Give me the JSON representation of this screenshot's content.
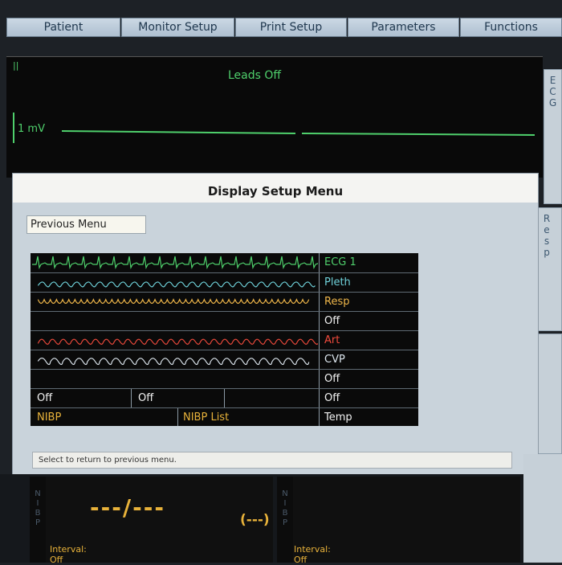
{
  "menu": {
    "tabs": [
      "Patient",
      "Monitor Setup",
      "Print Setup",
      "Parameters",
      "Functions"
    ]
  },
  "ecg_area": {
    "marker": "||",
    "status": "Leads Off",
    "scale": "1 mV",
    "side_label": [
      "E",
      "C",
      "G"
    ]
  },
  "resp_side_label": [
    "R",
    "e",
    "s",
    "p"
  ],
  "dialog": {
    "title": "Display Setup Menu",
    "previous_menu": "Previous Menu",
    "rows": [
      {
        "label": "ECG 1",
        "color": "#4fd06c"
      },
      {
        "label": "Pleth",
        "color": "#6fd1d9"
      },
      {
        "label": "Resp",
        "color": "#f0b74a"
      },
      {
        "label": "Off",
        "color": "#f2f2f2"
      },
      {
        "label": "Art",
        "color": "#ef4a3c"
      },
      {
        "label": "CVP",
        "color": "#dde6ee"
      },
      {
        "label": "Off",
        "color": "#f2f2f2"
      }
    ],
    "bottom_row1": [
      "Off",
      "Off",
      "",
      "Off"
    ],
    "bottom_row2": [
      "NIBP",
      "NIBP List",
      "Temp"
    ],
    "status_text": "Select to return to previous menu."
  },
  "nibp_panel": {
    "side_label": [
      "N",
      "I",
      "B",
      "P"
    ],
    "reading": "---/---",
    "mean": "(---)",
    "interval_label": "Interval:",
    "interval_value": "Off"
  },
  "nibp_panel_2": {
    "side_label": [
      "N",
      "I",
      "B",
      "P"
    ],
    "interval_label": "Interval:",
    "interval_value": "Off"
  },
  "colors": {
    "ecg_green": "#4fd06c",
    "nibp_amber": "#e8b23a",
    "dialog_bg": "#c9d3db",
    "tab_bg": "#b9c8d6"
  }
}
